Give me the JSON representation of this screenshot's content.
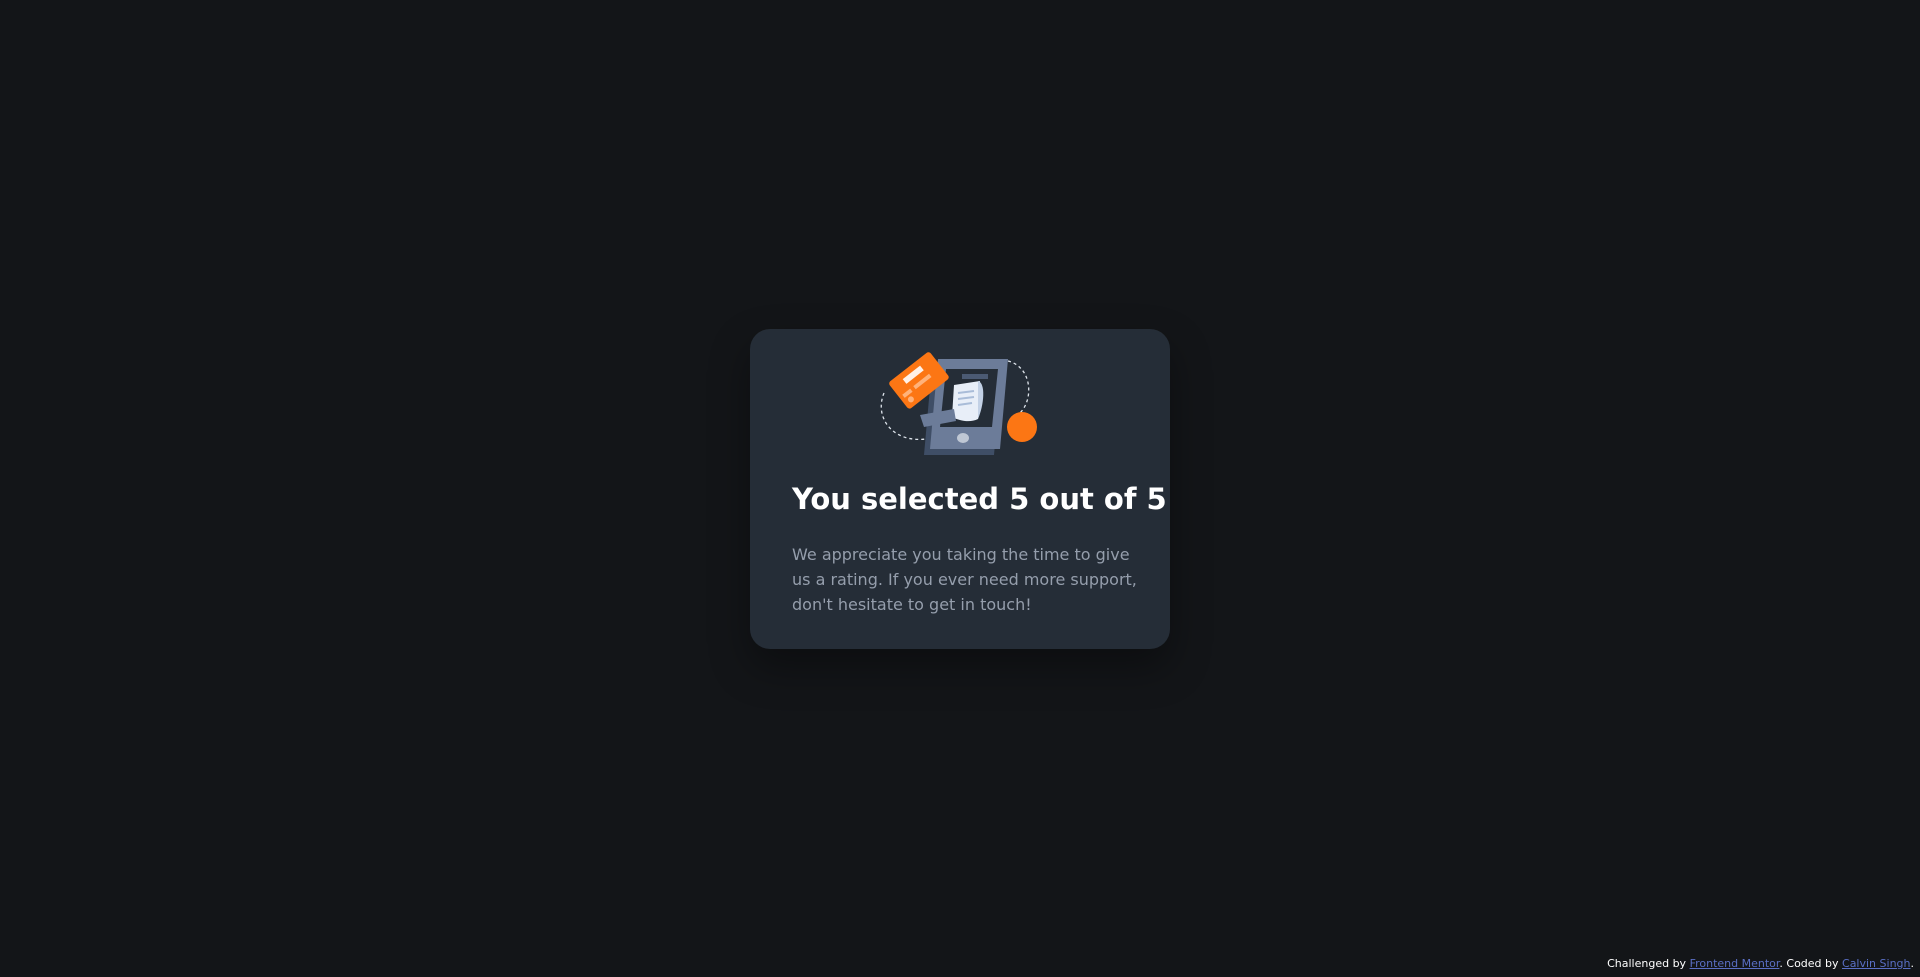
{
  "card": {
    "title": "You selected 5 out of 5",
    "message": "We appreciate you taking the time to give us a rating. If you ever need more support, don't hesitate to get in touch!"
  },
  "illustration": {
    "icon": "thank-you-phone-card-illustration"
  },
  "attribution": {
    "prefix": "Challenged by ",
    "link1_text": "Frontend Mentor",
    "middle": ". Coded by ",
    "link2_text": "Calvin Singh",
    "suffix": "."
  },
  "colors": {
    "background": "#131518",
    "card": "#252d37",
    "accent": "#fc7614",
    "text_muted": "#959eac",
    "link": "#5a6fc5"
  }
}
